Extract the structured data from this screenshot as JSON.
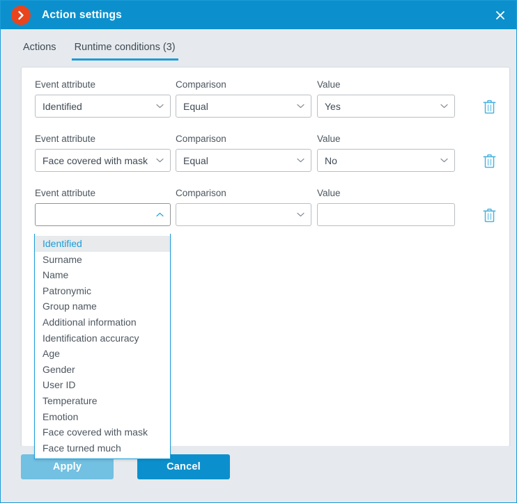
{
  "window": {
    "title": "Action settings",
    "logo_icon": "chevron-right-circle-icon",
    "close_icon": "close-icon",
    "accent_color": "#0c90cd",
    "logo_color": "#e8441d",
    "chrome_bg": "#e6eaee"
  },
  "tabs": [
    {
      "label": "Actions",
      "active": false
    },
    {
      "label": "Runtime conditions (3)",
      "active": true
    }
  ],
  "labels": {
    "event_attribute": "Event attribute",
    "comparison": "Comparison",
    "value": "Value"
  },
  "conditions": [
    {
      "attribute": "Identified",
      "comparison": "Equal",
      "value": "Yes",
      "attribute_open": false,
      "value_is_select": true,
      "delete_icon": "trash-icon"
    },
    {
      "attribute": "Face covered with mask",
      "comparison": "Equal",
      "value": "No",
      "attribute_open": false,
      "value_is_select": true,
      "delete_icon": "trash-icon"
    },
    {
      "attribute": "",
      "comparison": "",
      "value": "",
      "attribute_open": true,
      "value_is_select": false,
      "delete_icon": "trash-icon"
    }
  ],
  "dropdown": {
    "open": true,
    "selected": "Identified",
    "options": [
      "Identified",
      "Surname",
      "Name",
      "Patronymic",
      "Group name",
      "Additional information",
      "Identification accuracy",
      "Age",
      "Gender",
      "User ID",
      "Temperature",
      "Emotion",
      "Face covered with mask",
      "Face turned much"
    ]
  },
  "footer": {
    "apply_label": "Apply",
    "cancel_label": "Cancel",
    "apply_disabled": true
  }
}
